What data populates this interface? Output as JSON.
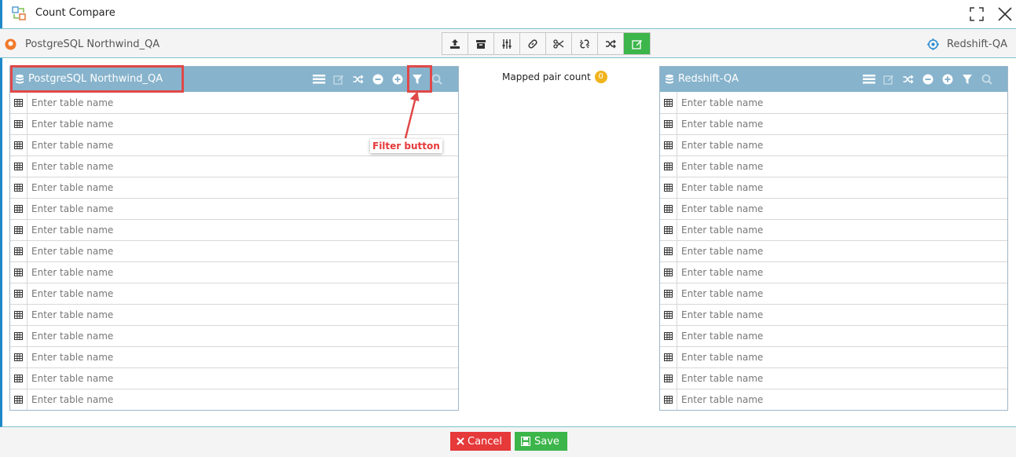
{
  "window": {
    "title": "Count Compare"
  },
  "toolbar": {
    "source_connection": "PostgreSQL Northwind_QA",
    "target_connection": "Redshift-QA",
    "buttons": [
      {
        "name": "upload-icon"
      },
      {
        "name": "archive-icon"
      },
      {
        "name": "sliders-icon"
      },
      {
        "name": "link-icon"
      },
      {
        "name": "scissors-icon"
      },
      {
        "name": "unlink-icon"
      },
      {
        "name": "shuffle-icon"
      },
      {
        "name": "edit-icon",
        "active": true
      }
    ]
  },
  "left_panel": {
    "title": "PostgreSQL Northwind_QA",
    "placeholder": "Enter table name",
    "rows": 15
  },
  "right_panel": {
    "title": "Redshift-QA",
    "placeholder": "Enter table name",
    "rows": 15
  },
  "mapped": {
    "label": "Mapped pair count",
    "count": "0"
  },
  "annotation": {
    "label": "Filter button"
  },
  "footer": {
    "cancel_label": "Cancel",
    "save_label": "Save"
  },
  "colors": {
    "header": "#87b3cc",
    "accent": "#1e88c8",
    "save": "#3cb54a",
    "cancel": "#e5393a",
    "badge": "#f0b41c"
  }
}
